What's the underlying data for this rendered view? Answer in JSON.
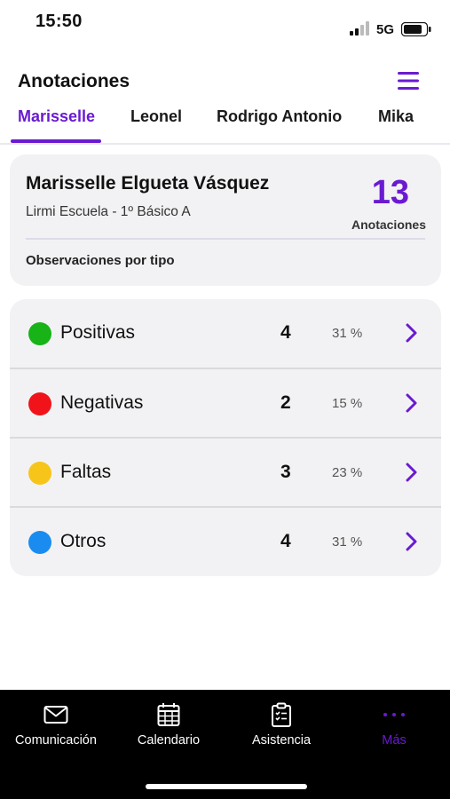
{
  "status_bar": {
    "time": "15:50",
    "network": "5G"
  },
  "header": {
    "title": "Anotaciones"
  },
  "tabs": [
    {
      "label": "Marisselle",
      "active": true
    },
    {
      "label": "Leonel",
      "active": false
    },
    {
      "label": "Rodrigo Antonio",
      "active": false
    },
    {
      "label": "Mika",
      "active": false
    }
  ],
  "summary": {
    "student_name": "Marisselle Elgueta Vásquez",
    "school": "Lirmi Escuela - 1º Básico A",
    "count": "13",
    "count_label": "Anotaciones",
    "section_label": "Observaciones por tipo"
  },
  "types": [
    {
      "label": "Positivas",
      "count": "4",
      "percent": "31 %",
      "color": "#17b317"
    },
    {
      "label": "Negativas",
      "count": "2",
      "percent": "15 %",
      "color": "#f0131a"
    },
    {
      "label": "Faltas",
      "count": "3",
      "percent": "23 %",
      "color": "#f7c51a"
    },
    {
      "label": "Otros",
      "count": "4",
      "percent": "31 %",
      "color": "#1a8cf0"
    }
  ],
  "bottom_nav": [
    {
      "label": "Comunicación",
      "icon": "mail-icon",
      "active": false
    },
    {
      "label": "Calendario",
      "icon": "calendar-icon",
      "active": false
    },
    {
      "label": "Asistencia",
      "icon": "clipboard-icon",
      "active": false
    },
    {
      "label": "Más",
      "icon": "more-dots-icon",
      "active": true
    }
  ],
  "colors": {
    "accent": "#6a1ad1",
    "card_bg": "#f2f2f4",
    "nav_bg": "#000000"
  }
}
